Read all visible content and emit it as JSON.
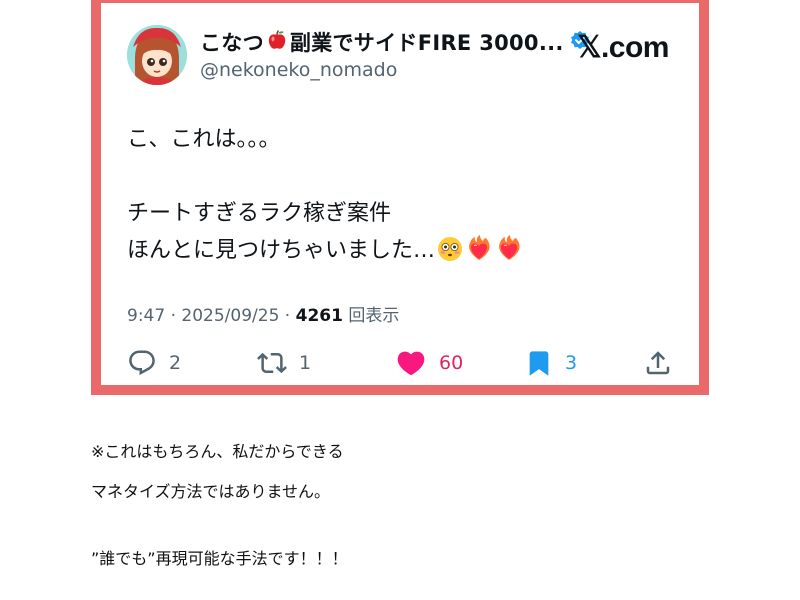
{
  "tweet": {
    "display_name_part1": "こなつ",
    "display_name_part2": "副業でサイドFIRE 3000...",
    "handle": "@nekoneko_nomado",
    "brand": "𝕏.com",
    "lines": [
      "こ、これは。。。",
      "",
      "チートすぎるラク稼ぎ案件",
      "ほんとに見つけちゃいました…"
    ],
    "time": "9:47",
    "date": "2025/09/25",
    "views_count": "4261",
    "views_label": "回表示",
    "actions": {
      "replies": "2",
      "reposts": "1",
      "likes": "60",
      "bookmarks": "3"
    }
  },
  "notes": [
    "※これはもちろん、私だからできる",
    "マネタイズ方法ではありません。",
    "”誰でも”再現可能な手法です！！！"
  ],
  "colors": {
    "frame": "#ea6a6a",
    "like": "#f91880",
    "bookmark": "#1d9bf0",
    "verified": "#1d9bf0"
  },
  "icons": [
    "apple-icon",
    "verified-icon",
    "flushed-face-emoji-icon",
    "heart-on-fire-emoji-icon",
    "reply-icon",
    "repost-icon",
    "like-heart-icon",
    "bookmark-icon",
    "share-icon"
  ]
}
